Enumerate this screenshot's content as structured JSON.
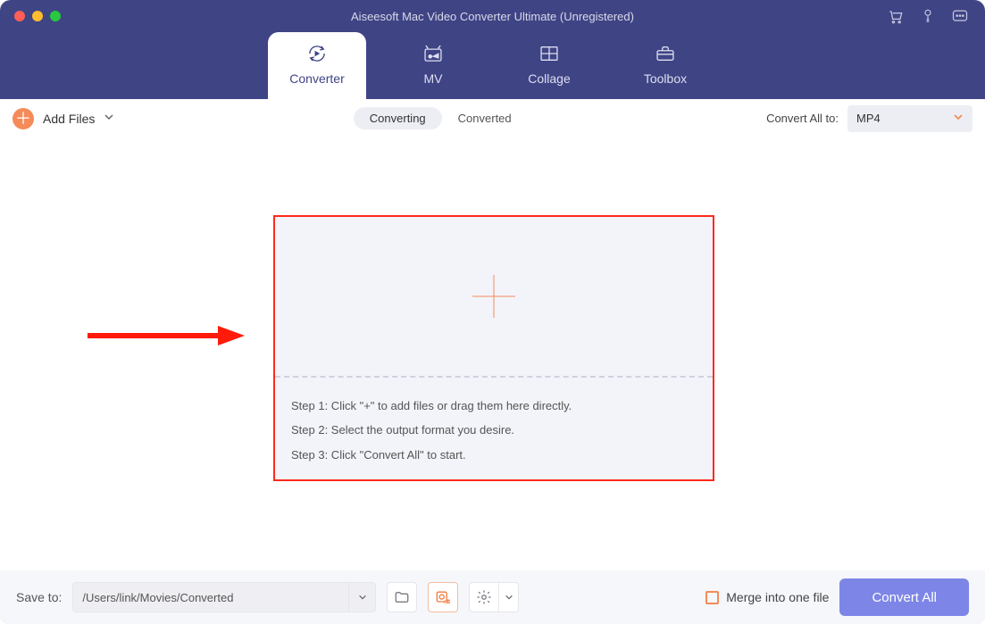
{
  "window": {
    "title": "Aiseesoft Mac Video Converter Ultimate (Unregistered)"
  },
  "nav": {
    "tabs": [
      {
        "label": "Converter"
      },
      {
        "label": "MV"
      },
      {
        "label": "Collage"
      },
      {
        "label": "Toolbox"
      }
    ]
  },
  "toolbar": {
    "add_files_label": "Add Files",
    "seg_converting": "Converting",
    "seg_converted": "Converted",
    "convert_all_to_label": "Convert All to:",
    "format_value": "MP4"
  },
  "dropzone": {
    "step1": "Step 1: Click \"+\" to add files or drag them here directly.",
    "step2": "Step 2: Select the output format you desire.",
    "step3": "Step 3: Click \"Convert All\" to start."
  },
  "bottom": {
    "save_to_label": "Save to:",
    "path": "/Users/link/Movies/Converted",
    "merge_label": "Merge into one file",
    "convert_all_btn": "Convert All"
  },
  "colors": {
    "brand_purple": "#3f4485",
    "accent_orange": "#f58b59",
    "annotation_red": "#ff2a1b",
    "primary_button": "#7d86e6"
  }
}
